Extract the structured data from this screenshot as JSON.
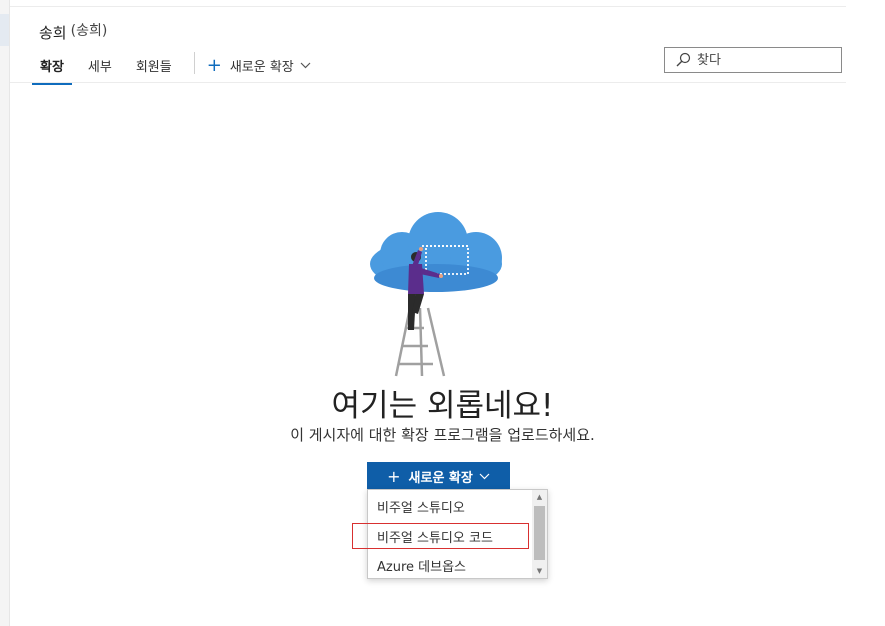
{
  "header": {
    "title": "송희",
    "subtitle": "(송희)"
  },
  "tabs": [
    {
      "label": "확장",
      "active": true
    },
    {
      "label": "세부",
      "active": false
    },
    {
      "label": "회원들",
      "active": false
    }
  ],
  "new_extension_menu": {
    "label": "새로운 확장",
    "icon": "plus-icon",
    "chevron_icon": "chevron-down-icon"
  },
  "search": {
    "placeholder": "찾다",
    "icon": "search-icon"
  },
  "empty_state": {
    "title": "여기는 외롭네요!",
    "description": "이 게시자에 대한 확장 프로그램을 업로드하세요.",
    "illustration": "person-on-ladder-cloud-illustration"
  },
  "primary_button": {
    "label": "새로운 확장",
    "bg_color": "#0f5ea8"
  },
  "dropdown": {
    "items": [
      {
        "label": "비주얼 스튜디오"
      },
      {
        "label": "비주얼 스튜디오 코드",
        "highlighted": true
      },
      {
        "label": "Azure 데브옵스"
      }
    ],
    "highlight_color": "#d83030"
  },
  "colors": {
    "accent": "#0f6cbd",
    "cloud": "#4a9be0",
    "person_shirt": "#5b2d8c"
  }
}
